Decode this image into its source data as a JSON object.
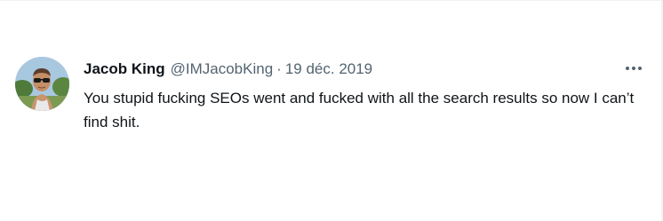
{
  "tweet": {
    "author_name": "Jacob King",
    "handle": "@IMJacobKing",
    "separator": "·",
    "date": "19 déc. 2019",
    "text": "You stupid fucking SEOs went and fucked with all the search results so now I can’t find shit.",
    "more_icon": "more-horizontal-icon"
  },
  "colors": {
    "primary_text": "#0f1419",
    "secondary_text": "#536471",
    "border": "#eff3f4"
  }
}
